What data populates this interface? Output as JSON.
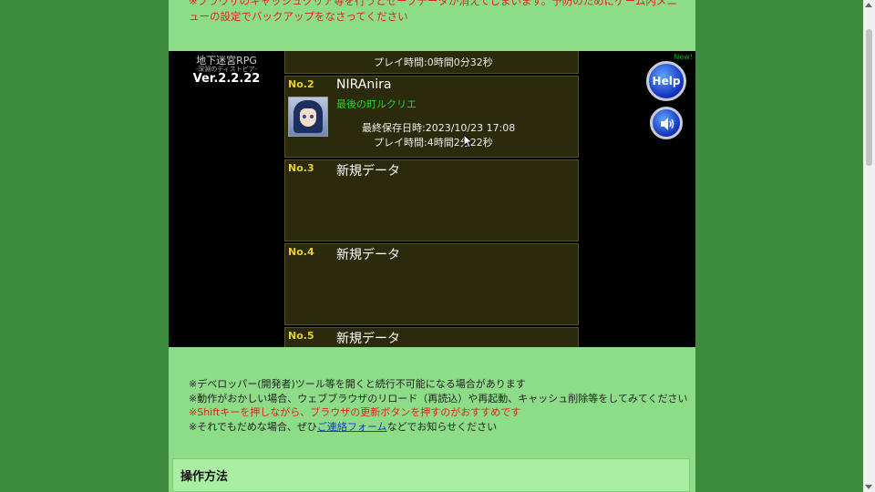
{
  "top_warning": "※ブラウザのキャッシュクリア等を行うとセーブデータが消えてしまいます。予防のためにゲーム内メニューの設定でバックアップをなさってください",
  "game": {
    "title": "地下迷宮RPG",
    "subtitle": "-深淵のディストピア-",
    "version": "Ver.2.2.22",
    "new_label": "New!",
    "help_label": "Help",
    "sound_icon": "speaker-icon",
    "slot_top_play": "プレイ時間:0時間0分32秒",
    "slots": [
      {
        "no": "No.2",
        "name": "NIRAnira",
        "location": "最後の町ルクリエ",
        "saved": "最終保存日時:2023/10/23 17:08",
        "play": "プレイ時間:4時間2分22秒"
      },
      {
        "no": "No.3",
        "name": "新規データ"
      },
      {
        "no": "No.4",
        "name": "新規データ"
      },
      {
        "no": "No.5",
        "name": "新規データ"
      }
    ]
  },
  "notes": {
    "line1": "※デベロッパー(開発者)ツール等を開くと続行不可能になる場合があります",
    "line2": "※動作がおかしい場合、ウェブブラウザのリロード（再読込）や再起動、キャッシュ削除等をしてみてください",
    "line3": "※Shiftキーを押しながら、ブラウザの更新ボタンを押すのがおすすめです",
    "line4_before": "※それでもだめな場合、ぜひ",
    "line4_link": "ご連絡フォーム",
    "line4_after": "などでお知らせください"
  },
  "howto": {
    "title": "操作方法"
  },
  "colors": {
    "page_bg": "#3d8b3d",
    "column_bg": "#8ddc87",
    "warning_red": "#e0231b",
    "slot_yellow": "#e8d02a",
    "location_green": "#26d42a"
  }
}
